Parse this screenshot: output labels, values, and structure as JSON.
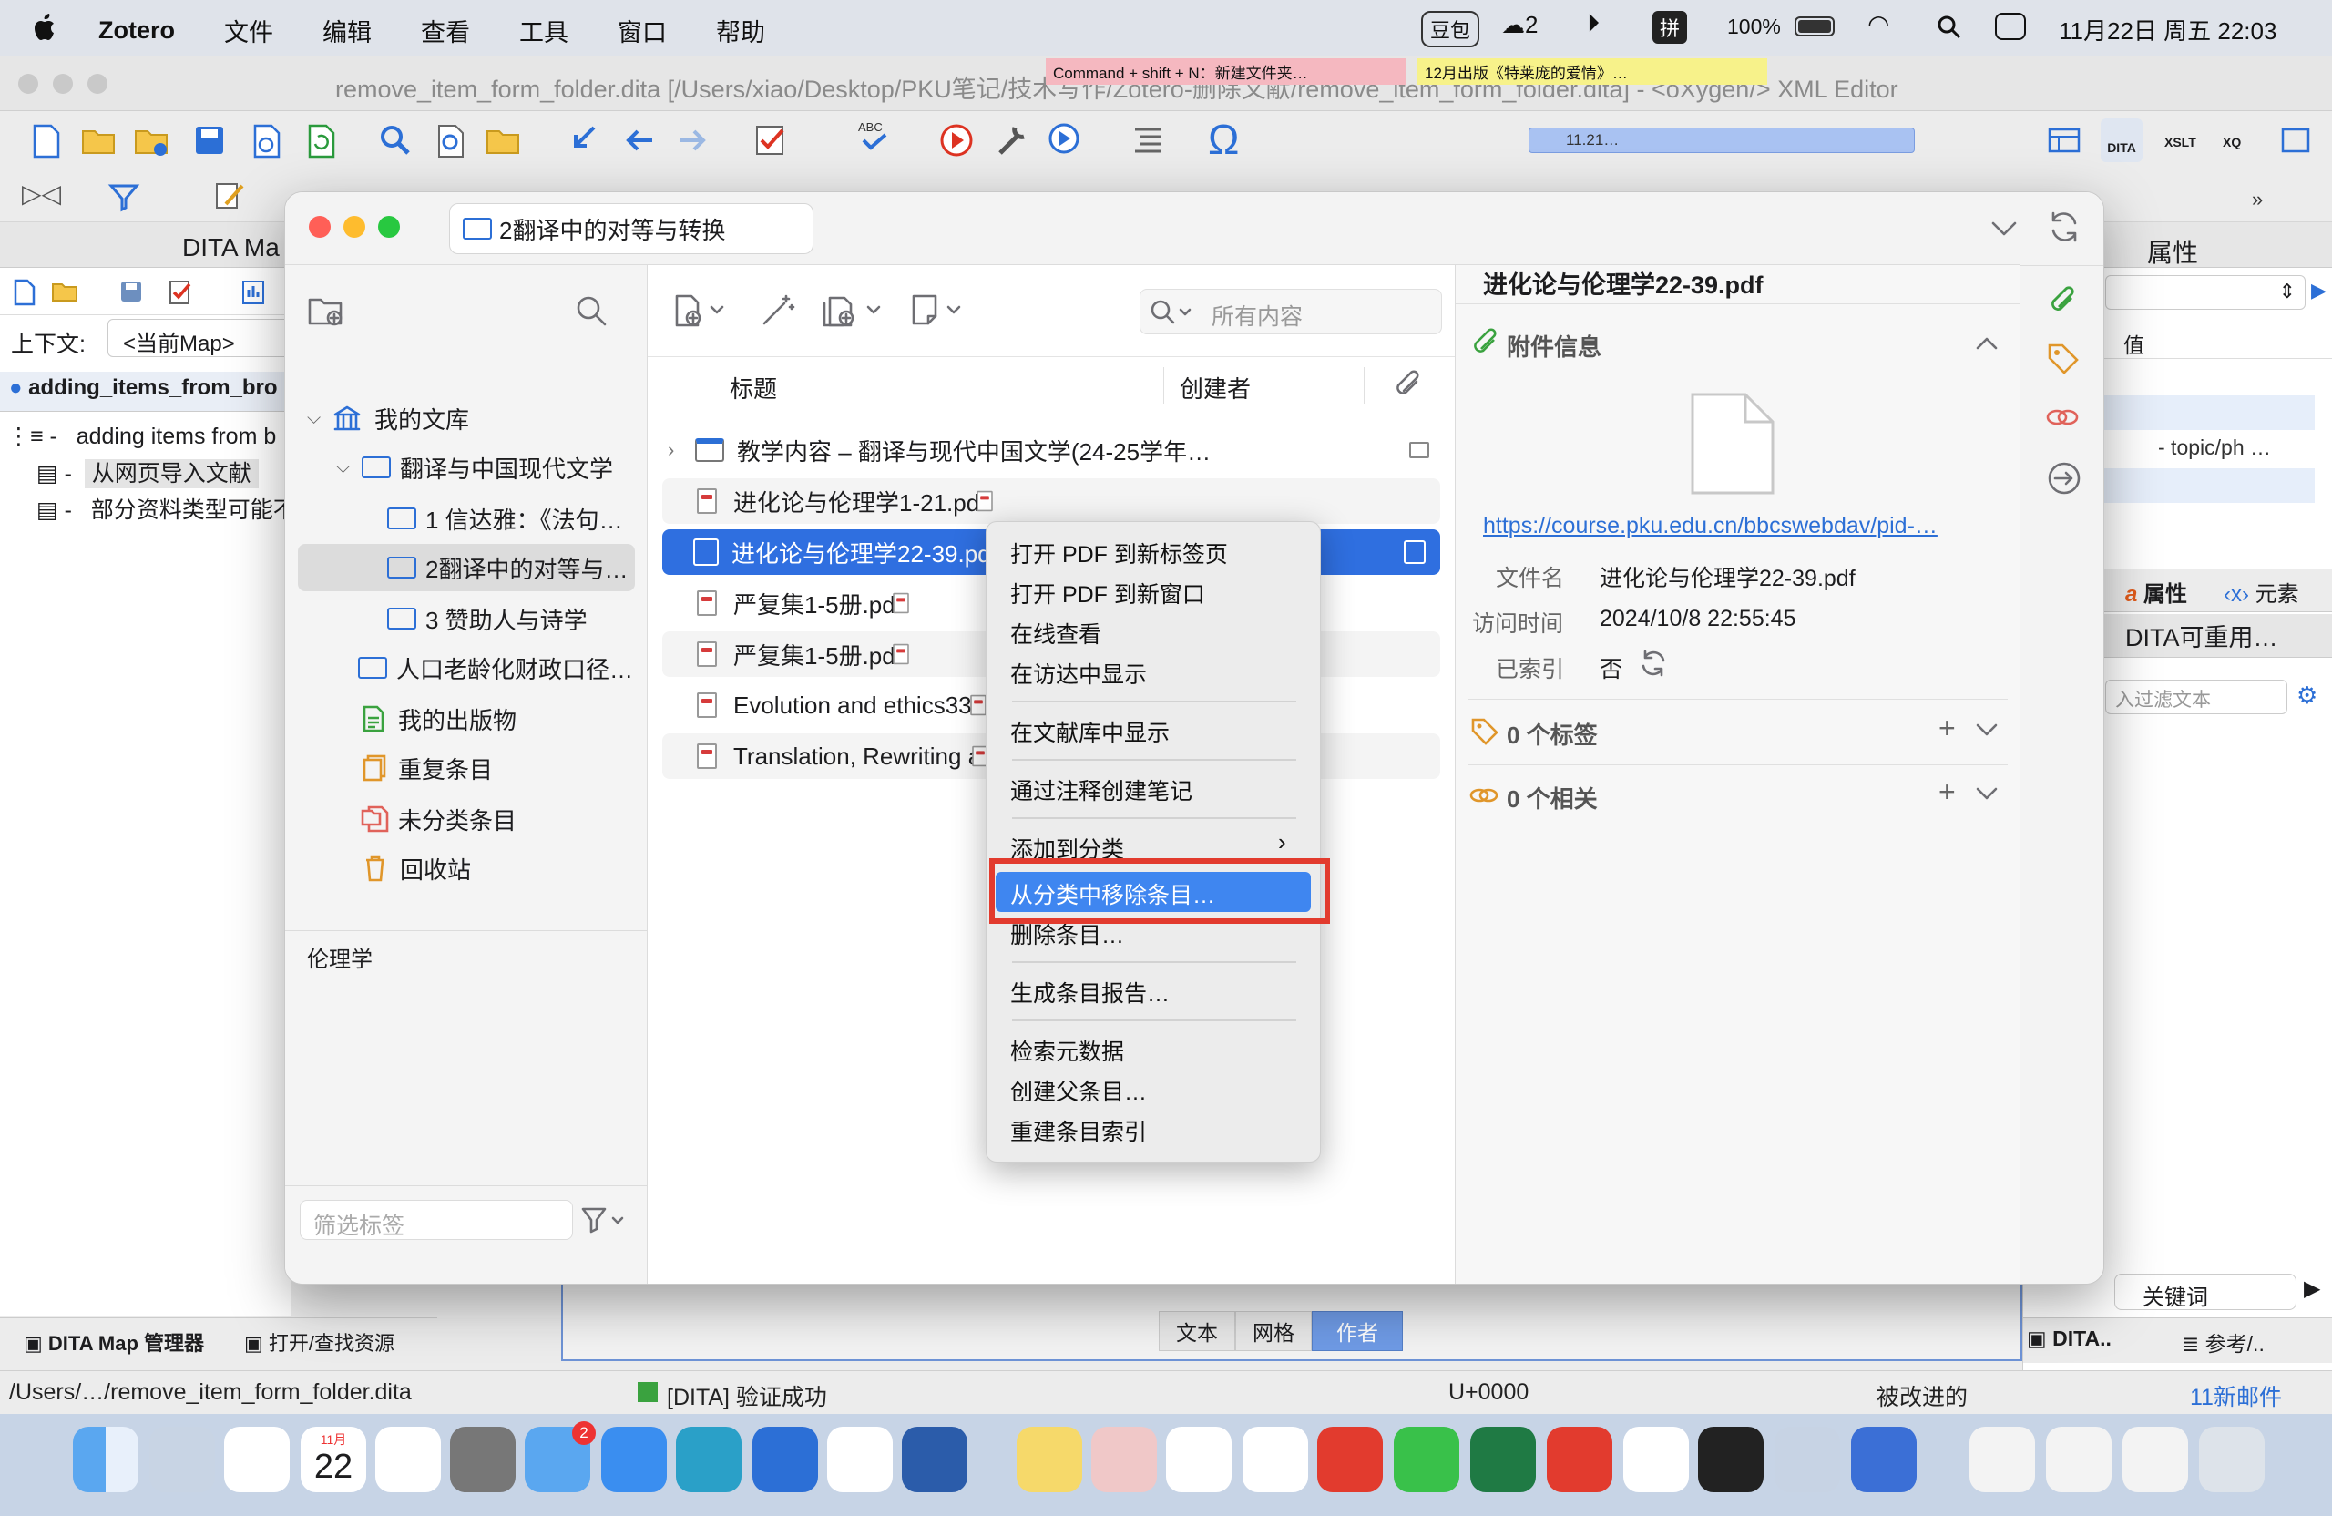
{
  "menubar": {
    "app": "Zotero",
    "items": [
      "文件",
      "编辑",
      "查看",
      "工具",
      "窗口",
      "帮助"
    ],
    "douban": "豆包",
    "badge_count": "2",
    "pinyin": "拼",
    "battery": "100%",
    "datetime": "11月22日 周五  22:03"
  },
  "oxygen": {
    "window_title": "remove_item_form_folder.dita [/Users/xiao/Desktop/PKU笔记/技术写作/Zotero-删除文献/remove_item_form_folder.dita] - <oXygen/> XML Editor",
    "sticky1": "Command + shift + N：新建文件夹…",
    "sticky2": "12月出版《特莱庞的爱情》…",
    "progress_label": "11.21…",
    "dita_panel": {
      "title": "DITA Ma",
      "context_label": "上下文:",
      "context_value": "<当前Map>",
      "tab": "adding_items_from_bro",
      "map_root": "adding items from b",
      "child1": "从网页导入文献",
      "child2": "部分资料类型可能不"
    },
    "right_panel": {
      "title": "属性",
      "col_value": "值",
      "attr_sample": "- topic/ph …",
      "tab_attr": "属性",
      "tab_elem": "元素",
      "dita_reuse": "DITA可重用…",
      "filter_placeholder": "入过滤文本",
      "keywords": "关键词",
      "btn_dita": "DITA..",
      "btn_ref": "参考/.."
    },
    "bottom_tabs": {
      "text": "文本",
      "grid": "网格",
      "author": "作者"
    },
    "left_tabs": {
      "map": "DITA Map 管理器",
      "open": "打开/查找资源"
    },
    "status": {
      "path": "/Users/…/remove_item_form_folder.dita",
      "validation": "[DITA] 验证成功",
      "unicode": "U+0000",
      "modified": "被改进的",
      "mail": "11新邮件"
    }
  },
  "zotero": {
    "collection_title": "2翻译中的对等与转换",
    "search_placeholder": "所有内容",
    "columns": {
      "title": "标题",
      "creator": "创建者"
    },
    "library": [
      {
        "label": "我的文库",
        "level": 0
      },
      {
        "label": "翻译与中国现代文学",
        "level": 1
      },
      {
        "label": "1 信达雅：《法句…",
        "level": 2
      },
      {
        "label": "2翻译中的对等与…",
        "level": 2,
        "selected": true
      },
      {
        "label": "3 赞助人与诗学",
        "level": 2
      },
      {
        "label": "人口老龄化财政口径…",
        "level": 1
      },
      {
        "label": "我的出版物",
        "level": 1
      },
      {
        "label": "重复条目",
        "level": 1
      },
      {
        "label": "未分类条目",
        "level": 1
      },
      {
        "label": "回收站",
        "level": 1
      }
    ],
    "tag_selector": "伦理学",
    "filter_tags_placeholder": "筛选标签",
    "items": [
      {
        "title": "教学内容 – 翻译与现代中国文学(24-25学年…",
        "type": "webpage"
      },
      {
        "title": "进化论与伦理学1-21.pdf",
        "type": "pdf"
      },
      {
        "title": "进化论与伦理学22-39.pdf",
        "type": "pdf",
        "selected": true
      },
      {
        "title": "严复集1-5册.pdf",
        "type": "pdf"
      },
      {
        "title": "严复集1-5册.pdf",
        "type": "pdf"
      },
      {
        "title": "Evolution and ethics33-",
        "type": "pdf"
      },
      {
        "title": "Translation, Rewriting a",
        "type": "pdf"
      }
    ],
    "detail": {
      "header": "进化论与伦理学22-39.pdf",
      "section": "附件信息",
      "url": "https://course.pku.edu.cn/bbcswebdav/pid-…",
      "filename_label": "文件名",
      "filename": "进化论与伦理学22-39.pdf",
      "accessed_label": "访问时间",
      "accessed": "2024/10/8 22:55:45",
      "indexed_label": "已索引",
      "indexed": "否",
      "tags": "0 个标签",
      "related": "0 个相关"
    }
  },
  "context_menu": {
    "items": [
      "打开 PDF 到新标签页",
      "打开 PDF 到新窗口",
      "在线查看",
      "在访达中显示",
      "在文献库中显示",
      "通过注释创建笔记",
      "添加到分类",
      "从分类中移除条目…",
      "删除条目…",
      "生成条目报告…",
      "检索元数据",
      "创建父条目…",
      "重建条目索引"
    ],
    "highlight_color": "#e23b2e",
    "selection_color": "#2f6fe0"
  },
  "dock": {
    "calendar_month": "11月",
    "calendar_day": "22",
    "mail_badge": "2"
  }
}
